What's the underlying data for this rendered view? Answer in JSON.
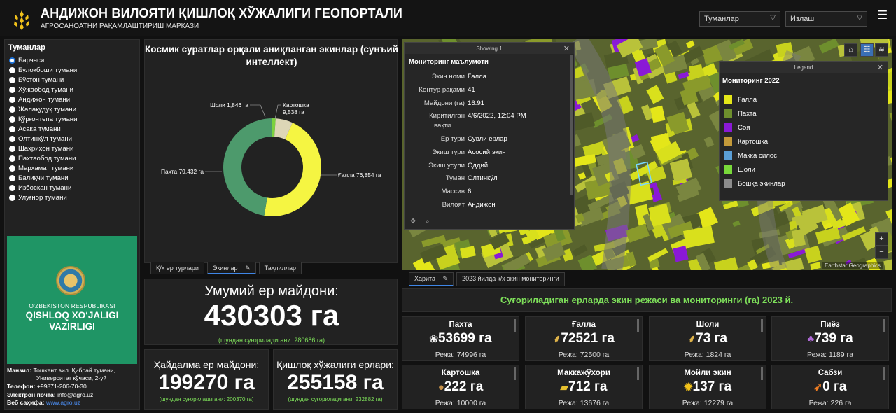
{
  "header": {
    "title": "АНДИЖОН ВИЛОЯТИ ҚИШЛОҚ ХЎЖАЛИГИ ГЕОПОРТАЛИ",
    "subtitle": "АГРОСАНОАТНИ РАҚАМЛАШТИРИШ МАРКАЗИ",
    "select_districts": "Туманлар",
    "select_search": "Излаш",
    "menu_icon": "hamburger-icon"
  },
  "districts": {
    "title": "Туманлар",
    "items": [
      "Барчаси",
      "Булоқбоши тумани",
      "Бўстон тумани",
      "Хўжаобод тумани",
      "Андижон тумани",
      "Жалақудуқ тумани",
      "Қўрғонтепа тумани",
      "Асака тумани",
      "Олтинкўл тумани",
      "Шахрихон тумани",
      "Пахтаобод тумани",
      "Мархамат тумани",
      "Балиқчи тумани",
      "Избоскан тумани",
      "Улуғнор тумани"
    ],
    "selected": "Барчаси"
  },
  "emblem": {
    "line1": "O‘ZBEKISTON RESPUBLIKASI",
    "line2": "QISHLOQ XO‘JALIGI",
    "line3": "VAZIRLIGI"
  },
  "contact": {
    "address_label": "Манзил:",
    "address": "Тошкент вил. Қибрай тумани,",
    "address2": "Университет кўчаси, 2-уй",
    "phone_label": "Телефон:",
    "phone": "+99871-206-70-30",
    "email_label": "Электрон почта:",
    "email": "info@agro.uz",
    "web_label": "Веб саҳифа:",
    "web": "www.agro.uz"
  },
  "chart_data": {
    "type": "pie",
    "title": "Космик суратлар орқали аниқланган экинлар (сунъий интеллект)",
    "slices": [
      {
        "label": "Ғалла",
        "value": 76854,
        "text": "Ғалла 76,854 га",
        "color": "#f5f542"
      },
      {
        "label": "Пахта",
        "value": 79432,
        "text": "Пахта 79,432 га",
        "color": "#4d9a6c"
      },
      {
        "label": "Шоли",
        "value": 1846,
        "text": "Шоли 1,846 га",
        "color": "#7bd23e"
      },
      {
        "label": "Картошка",
        "value": 9538,
        "text": "Картошка 9,538 га",
        "color": "#ddd6b6"
      }
    ]
  },
  "chart_labels": {
    "sholi_name": "Шоли 1,846 га",
    "kart_name": "Картошка",
    "kart_val": "9,538 га",
    "pakhta": "Пахта 79,432 га",
    "galla": "Ғалла 76,854 га"
  },
  "chart_tabs": [
    "Қ/х ер турлари",
    "Экинлар",
    "Таҳлиллар"
  ],
  "total": {
    "label": "Умумий ер майдони:",
    "value": "430303 га",
    "sub": "(шундан суғориладигани: 280686 га)"
  },
  "arable": {
    "label": "Ҳайдалма ер майдони:",
    "value": "199270 га",
    "sub": "(шундан суғориладигани: 200370 га)"
  },
  "agri": {
    "label": "Қишлоқ хўжалиги ерлари:",
    "value": "255158 га",
    "sub": "(шундан суғориладигани: 232882 га)"
  },
  "popup": {
    "head": "Showing 1",
    "title": "Мониторинг маълумоти",
    "rows": [
      {
        "k": "Экин номи",
        "v": "Ғалла"
      },
      {
        "k": "Контур рақами",
        "v": "41"
      },
      {
        "k": "Майдони (га)",
        "v": "16.91"
      },
      {
        "k": "Киритилган",
        "k2": "вақти",
        "v": "4/6/2022, 12:04 PM"
      },
      {
        "k": "Ер тури",
        "v": "Сувли ерлар"
      },
      {
        "k": "Экиш тури",
        "v": "Асосий экин"
      },
      {
        "k": "Экиш усули",
        "v": "Оддий"
      },
      {
        "k": "Туман",
        "v": "Олтинкўл"
      },
      {
        "k": "Массив",
        "v": "6"
      },
      {
        "k": "Вилоят",
        "v": "Андижон"
      }
    ]
  },
  "legend": {
    "head": "Legend",
    "title": "Мониторинг 2022",
    "items": [
      {
        "label": "Ғалла",
        "color": "#e4e619"
      },
      {
        "label": "Пахта",
        "color": "#6e8f2d"
      },
      {
        "label": "Соя",
        "color": "#8a19d6"
      },
      {
        "label": "Картошка",
        "color": "#c49a3a"
      },
      {
        "label": "Макка силос",
        "color": "#5a9ed6"
      },
      {
        "label": "Шоли",
        "color": "#79d93a"
      },
      {
        "label": "Бошқа экинлар",
        "color": "#8c8c8c"
      }
    ]
  },
  "map": {
    "attribution": "Earthstar Geographics",
    "tabs": [
      "Харита",
      "2023 йилда қ/х экин мониторинги"
    ]
  },
  "banner": "Суғориладиган ерларда экин режаси ва мониторинги (га) 2023 й.",
  "crops": [
    {
      "name": "Пахта",
      "value": "53699 га",
      "plan": "Режа: 74996 га",
      "icon": "cotton-icon",
      "glyph": "❀",
      "gc": "#f2f2f2"
    },
    {
      "name": "Ғалла",
      "value": "72521 га",
      "plan": "Режа: 72500 га",
      "icon": "wheat-icon",
      "glyph": "⸙",
      "gc": "#e0b44a"
    },
    {
      "name": "Шоли",
      "value": "73 га",
      "plan": "Режа: 1824 га",
      "icon": "rice-icon",
      "glyph": "⸙",
      "gc": "#e0b44a"
    },
    {
      "name": "Пиёз",
      "value": "739 га",
      "plan": "Режа: 1189 га",
      "icon": "onion-icon",
      "glyph": "♣",
      "gc": "#b06ad8"
    },
    {
      "name": "Картошка",
      "value": "222 га",
      "plan": "Режа: 10000 га",
      "icon": "potato-icon",
      "glyph": "●",
      "gc": "#c9934a"
    },
    {
      "name": "Маккажўхори",
      "value": "712 га",
      "plan": "Режа: 13676 га",
      "icon": "corn-icon",
      "glyph": "▰",
      "gc": "#e6c02e"
    },
    {
      "name": "Мойли экин",
      "value": "137 га",
      "plan": "Режа: 12279 га",
      "icon": "sunflower-icon",
      "glyph": "✹",
      "gc": "#f2c21a"
    },
    {
      "name": "Сабзи",
      "value": "0 га",
      "plan": "Режа: 226 га",
      "icon": "carrot-icon",
      "glyph": "➶",
      "gc": "#ef7d22"
    }
  ]
}
